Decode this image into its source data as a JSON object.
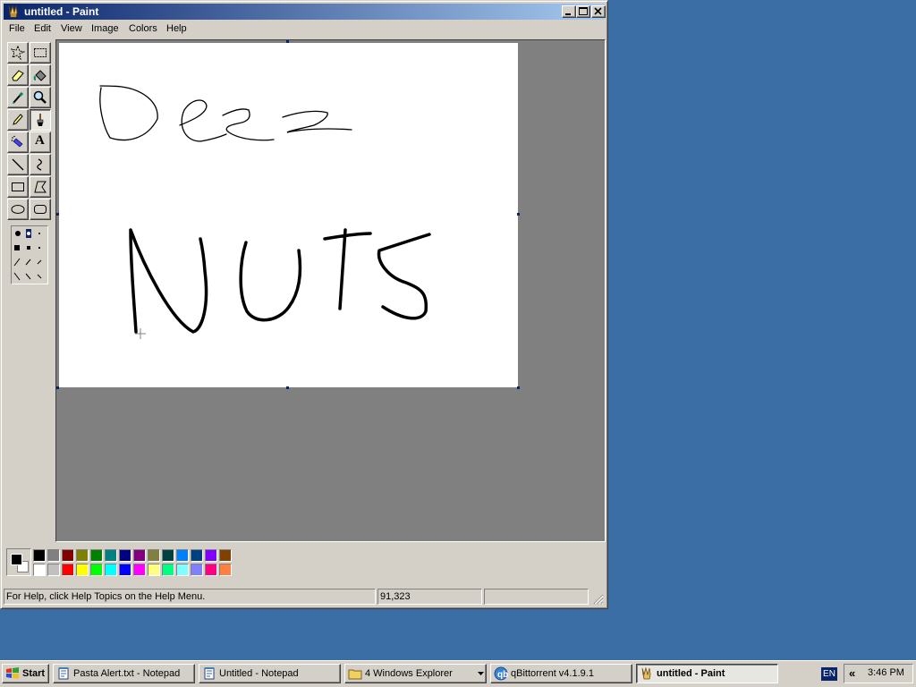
{
  "window": {
    "title": "untitled - Paint"
  },
  "menu": [
    "File",
    "Edit",
    "View",
    "Image",
    "Colors",
    "Help"
  ],
  "tools": [
    {
      "name": "free-form-select-tool",
      "icon": "free-select-icon"
    },
    {
      "name": "select-tool",
      "icon": "rect-select-icon"
    },
    {
      "name": "eraser-tool",
      "icon": "eraser-icon"
    },
    {
      "name": "fill-tool",
      "icon": "paint-bucket-icon"
    },
    {
      "name": "pick-color-tool",
      "icon": "eyedropper-icon"
    },
    {
      "name": "magnifier-tool",
      "icon": "magnifier-icon"
    },
    {
      "name": "pencil-tool",
      "icon": "pencil-icon"
    },
    {
      "name": "brush-tool",
      "icon": "brush-icon",
      "selected": true
    },
    {
      "name": "airbrush-tool",
      "icon": "airbrush-icon"
    },
    {
      "name": "text-tool",
      "icon": "text-icon",
      "glyph": "A"
    },
    {
      "name": "line-tool",
      "icon": "line-icon"
    },
    {
      "name": "curve-tool",
      "icon": "curve-icon"
    },
    {
      "name": "rectangle-tool",
      "icon": "rectangle-icon"
    },
    {
      "name": "polygon-tool",
      "icon": "polygon-icon"
    },
    {
      "name": "ellipse-tool",
      "icon": "ellipse-icon"
    },
    {
      "name": "rounded-rectangle-tool",
      "icon": "rounded-rectangle-icon"
    }
  ],
  "colors": {
    "foreground": "#000000",
    "background": "#ffffff",
    "palette_top": [
      "#000000",
      "#808080",
      "#800000",
      "#808000",
      "#008000",
      "#008080",
      "#000080",
      "#800080",
      "#808040",
      "#004040",
      "#0080ff",
      "#004080",
      "#8000ff",
      "#804000"
    ],
    "palette_bottom": [
      "#ffffff",
      "#c0c0c0",
      "#ff0000",
      "#ffff00",
      "#00ff00",
      "#00ffff",
      "#0000ff",
      "#ff00ff",
      "#ffff80",
      "#00ff80",
      "#80ffff",
      "#8080ff",
      "#ff0080",
      "#ff8040"
    ]
  },
  "status": {
    "help": "For Help, click Help Topics on the Help Menu.",
    "coords": "91,323",
    "size": ""
  },
  "taskbar": {
    "start": "Start",
    "items": [
      {
        "label": "Pasta Alert.txt - Notepad",
        "icon": "notepad-icon"
      },
      {
        "label": "Untitled - Notepad",
        "icon": "notepad-icon"
      },
      {
        "label": "4 Windows Explorer",
        "icon": "folder-icon"
      },
      {
        "label": "qBittorrent v4.1.9.1",
        "icon": "qbittorrent-icon"
      },
      {
        "label": "untitled - Paint",
        "icon": "paint-icon",
        "active": true
      }
    ],
    "language": "EN",
    "tray_chevron": "«",
    "clock": "3:46 PM"
  }
}
